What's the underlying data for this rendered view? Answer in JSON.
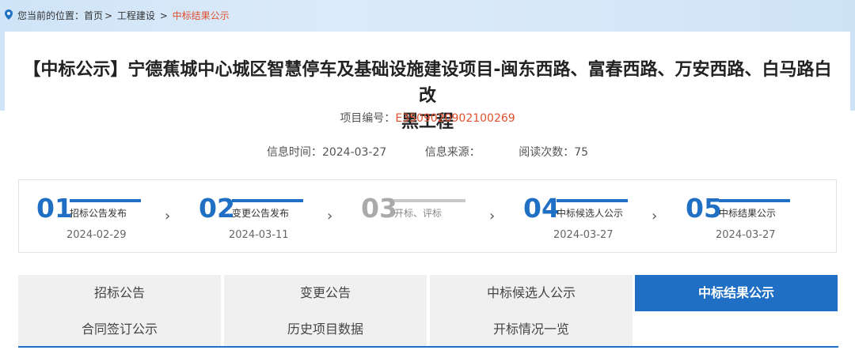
{
  "breadcrumb": {
    "prefix": "您当前的位置：",
    "home": "首页",
    "section": "工程建设",
    "current": "中标结果公示"
  },
  "title_line1": "【中标公示】宁德蕉城中心城区智慧停车及基础设施建设项目-闽东西路、富春西路、万安西路、白马路白改",
  "title_line2": "黑工程",
  "project_no": {
    "label": "项目编号：",
    "value": "E3509020902100269"
  },
  "meta": {
    "time_label": "信息时间：",
    "time_value": "2024-03-27",
    "source_label": "信息来源：",
    "source_value": "",
    "views_label": "阅读次数：",
    "views_value": "75"
  },
  "steps": [
    {
      "num": "01",
      "name": "招标公告发布",
      "date": "2024-02-29"
    },
    {
      "num": "02",
      "name": "变更公告发布",
      "date": "2024-03-11"
    },
    {
      "num": "03",
      "name": "开标、评标",
      "date": ""
    },
    {
      "num": "04",
      "name": "中标候选人公示",
      "date": "2024-03-27"
    },
    {
      "num": "05",
      "name": "中标结果公示",
      "date": "2024-03-27"
    }
  ],
  "arrow_glyph": "›",
  "tabs": [
    {
      "label": "招标公告"
    },
    {
      "label": "变更公告"
    },
    {
      "label": "中标候选人公示"
    },
    {
      "label": "中标结果公示"
    },
    {
      "label": "合同签订公示"
    },
    {
      "label": "历史项目数据"
    },
    {
      "label": "开标情况一览"
    }
  ],
  "colors": {
    "accent": "#1f6fc4",
    "highlight": "#e0502f"
  }
}
